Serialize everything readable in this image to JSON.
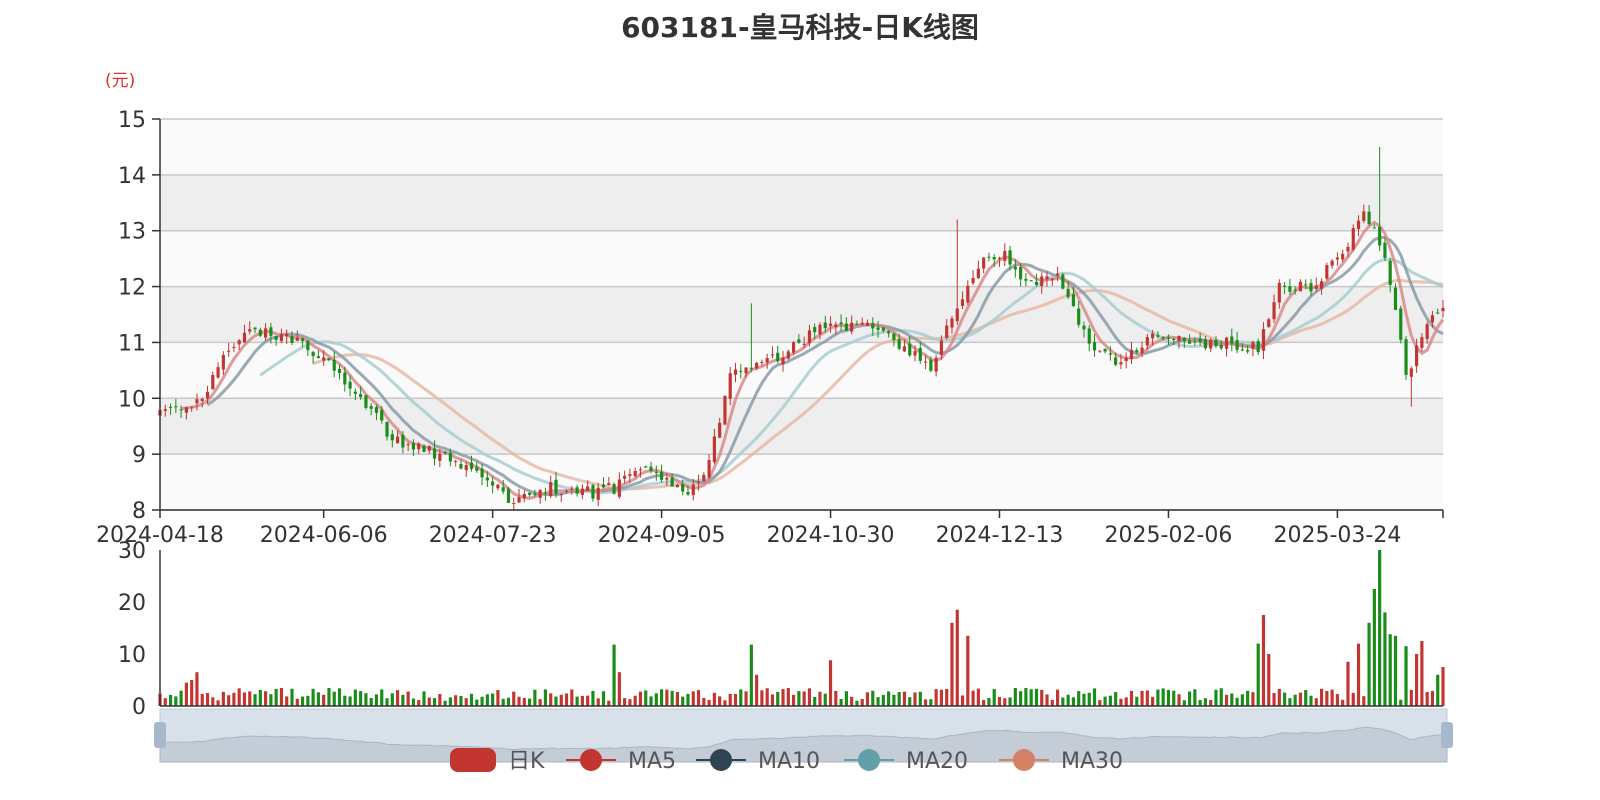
{
  "chart_data": {
    "type": "candlestick",
    "title": "603181-皇马科技-日K线图",
    "yunit": "(元)",
    "price_ylim": [
      8,
      15
    ],
    "price_yticks": [
      8,
      9,
      10,
      11,
      12,
      13,
      14,
      15
    ],
    "volume_ylim": [
      0,
      30
    ],
    "volume_yticks": [
      0,
      10,
      20,
      30
    ],
    "x_tick_labels": [
      "2024-04-18",
      "2024-06-06",
      "2024-07-23",
      "2024-09-05",
      "2024-10-30",
      "2024-12-13",
      "2025-02-06",
      "2025-03-24"
    ],
    "x_tick_index": [
      0,
      31,
      63,
      95,
      127,
      159,
      191,
      223
    ],
    "grid": true,
    "legend": [
      "日K",
      "MA5",
      "MA10",
      "MA20",
      "MA30"
    ],
    "colors": {
      "up": "#c23531",
      "down": "#1a8c1a",
      "ma5": "#d98888",
      "ma10": "#8a9aa4",
      "ma20": "#a8ccd0",
      "ma30": "#e6b8a4",
      "red_label": "#e03030",
      "band": "#eeeeee",
      "band_alt": "#fafafa",
      "slider": "#d8e0ea",
      "slider_handle": "#a7b7cc"
    },
    "close_anchors": [
      [
        0,
        9.8
      ],
      [
        8,
        10.0
      ],
      [
        12,
        10.8
      ],
      [
        18,
        11.2
      ],
      [
        26,
        11.0
      ],
      [
        32,
        10.7
      ],
      [
        38,
        10.0
      ],
      [
        44,
        9.3
      ],
      [
        52,
        9.0
      ],
      [
        60,
        8.7
      ],
      [
        66,
        8.2
      ],
      [
        74,
        8.4
      ],
      [
        82,
        8.3
      ],
      [
        86,
        8.4
      ],
      [
        92,
        8.8
      ],
      [
        96,
        8.6
      ],
      [
        100,
        8.3
      ],
      [
        104,
        8.8
      ],
      [
        108,
        10.5
      ],
      [
        112,
        10.6
      ],
      [
        118,
        10.8
      ],
      [
        124,
        11.2
      ],
      [
        134,
        11.3
      ],
      [
        146,
        10.6
      ],
      [
        150,
        11.4
      ],
      [
        156,
        12.5
      ],
      [
        160,
        12.6
      ],
      [
        164,
        12.1
      ],
      [
        170,
        12.2
      ],
      [
        176,
        11.0
      ],
      [
        182,
        10.6
      ],
      [
        188,
        11.1
      ],
      [
        196,
        11.0
      ],
      [
        202,
        11.0
      ],
      [
        208,
        10.9
      ],
      [
        212,
        12.0
      ],
      [
        218,
        12.0
      ],
      [
        224,
        12.6
      ],
      [
        228,
        13.4
      ],
      [
        232,
        12.6
      ],
      [
        236,
        10.4
      ],
      [
        240,
        11.3
      ],
      [
        243,
        11.7
      ]
    ],
    "volume_spikes": [
      [
        5,
        4.5
      ],
      [
        6,
        5.0
      ],
      [
        7,
        6.5
      ],
      [
        86,
        11.8
      ],
      [
        87,
        6.5
      ],
      [
        112,
        11.8
      ],
      [
        113,
        6.0
      ],
      [
        127,
        8.8
      ],
      [
        150,
        16.0
      ],
      [
        151,
        18.5
      ],
      [
        153,
        13.5
      ],
      [
        208,
        12.0
      ],
      [
        209,
        17.5
      ],
      [
        210,
        10.0
      ],
      [
        225,
        8.5
      ],
      [
        227,
        12.0
      ],
      [
        229,
        16.0
      ],
      [
        230,
        22.5
      ],
      [
        231,
        30.0
      ],
      [
        232,
        18.0
      ],
      [
        233,
        13.8
      ],
      [
        234,
        13.5
      ],
      [
        236,
        11.5
      ],
      [
        238,
        10.0
      ],
      [
        239,
        12.5
      ],
      [
        242,
        6.0
      ],
      [
        243,
        7.5
      ]
    ],
    "num_days": 244
  }
}
